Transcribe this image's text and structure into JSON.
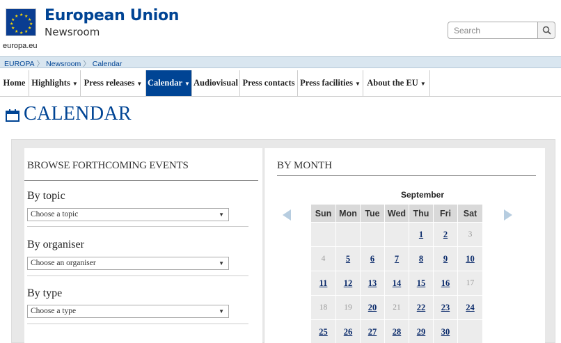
{
  "header": {
    "site_title": "European Union",
    "site_subtitle": "Newsroom",
    "logo_caption": "europa.eu",
    "search_placeholder": "Search"
  },
  "breadcrumb": [
    "EUROPA",
    "Newsroom",
    "Calendar"
  ],
  "nav": {
    "items": [
      {
        "label": "Home",
        "dropdown": false,
        "active": false
      },
      {
        "label": "Highlights",
        "dropdown": true,
        "active": false
      },
      {
        "label": "Press releases",
        "dropdown": true,
        "active": false
      },
      {
        "label": "Calendar",
        "dropdown": true,
        "active": true
      },
      {
        "label": "Audiovisual",
        "dropdown": false,
        "active": false
      },
      {
        "label": "Press contacts",
        "dropdown": false,
        "active": false
      },
      {
        "label": "Press facilities",
        "dropdown": true,
        "active": false
      },
      {
        "label": "About the EU",
        "dropdown": true,
        "active": false
      }
    ]
  },
  "page_title": "CALENDAR",
  "browse": {
    "title": "BROWSE FORTHCOMING EVENTS",
    "filters": [
      {
        "label": "By topic",
        "value": "Choose a topic"
      },
      {
        "label": "By organiser",
        "value": "Choose an organiser"
      },
      {
        "label": "By type",
        "value": "Choose a type"
      }
    ]
  },
  "by_month": {
    "title": "BY MONTH",
    "month": "September",
    "weekdays": [
      "Sun",
      "Mon",
      "Tue",
      "Wed",
      "Thu",
      "Fri",
      "Sat"
    ],
    "weeks": [
      [
        null,
        null,
        null,
        null,
        {
          "d": "1",
          "link": true
        },
        {
          "d": "2",
          "link": true
        },
        {
          "d": "3",
          "link": false
        }
      ],
      [
        {
          "d": "4",
          "link": false
        },
        {
          "d": "5",
          "link": true
        },
        {
          "d": "6",
          "link": true
        },
        {
          "d": "7",
          "link": true
        },
        {
          "d": "8",
          "link": true
        },
        {
          "d": "9",
          "link": true
        },
        {
          "d": "10",
          "link": true
        }
      ],
      [
        {
          "d": "11",
          "link": true
        },
        {
          "d": "12",
          "link": true
        },
        {
          "d": "13",
          "link": true
        },
        {
          "d": "14",
          "link": true
        },
        {
          "d": "15",
          "link": true
        },
        {
          "d": "16",
          "link": true
        },
        {
          "d": "17",
          "link": false
        }
      ],
      [
        {
          "d": "18",
          "link": false
        },
        {
          "d": "19",
          "link": false
        },
        {
          "d": "20",
          "link": true
        },
        {
          "d": "21",
          "link": false
        },
        {
          "d": "22",
          "link": true
        },
        {
          "d": "23",
          "link": true
        },
        {
          "d": "24",
          "link": true
        }
      ],
      [
        {
          "d": "25",
          "link": true
        },
        {
          "d": "26",
          "link": true
        },
        {
          "d": "27",
          "link": true
        },
        {
          "d": "28",
          "link": true
        },
        {
          "d": "29",
          "link": true
        },
        {
          "d": "30",
          "link": true
        },
        null
      ]
    ]
  },
  "colors": {
    "brand_blue": "#004494",
    "active_nav_bg": "#004494",
    "breadcrumb_bg": "#d9e6f0",
    "link_day": "#0b2b6b",
    "muted_day": "#9a9a9a"
  }
}
